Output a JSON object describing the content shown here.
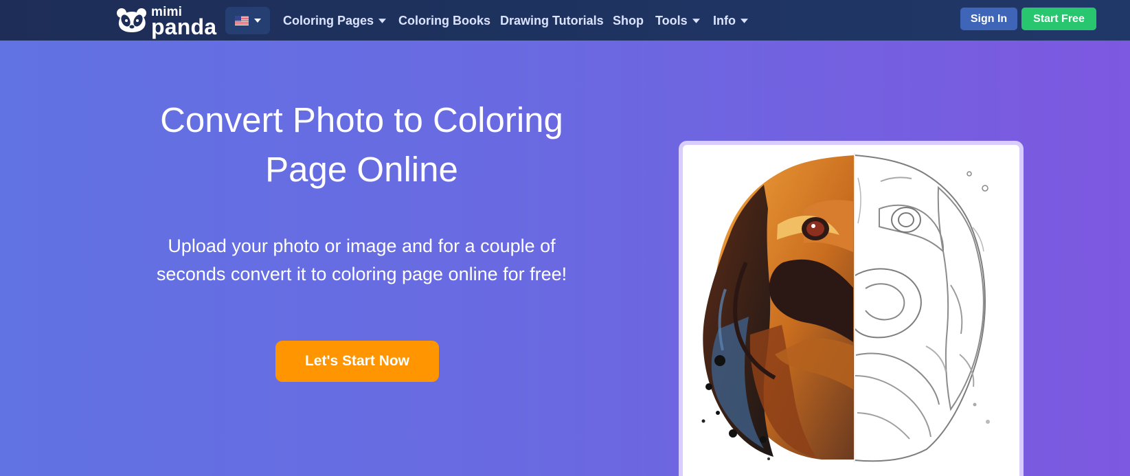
{
  "nav": {
    "logo": {
      "top_word": "mimi",
      "bottom_word": "panda",
      "icon": "panda-face-icon"
    },
    "language": {
      "flag": "us-flag-icon",
      "caret": "chevron-down-icon"
    },
    "items": [
      {
        "label": "Coloring Pages",
        "dropdown": true
      },
      {
        "label": "Coloring Books",
        "dropdown": false
      },
      {
        "label": "Drawing Tutorials",
        "dropdown": false
      },
      {
        "label": "Shop",
        "dropdown": false
      },
      {
        "label": "Tools",
        "dropdown": true
      },
      {
        "label": "Info",
        "dropdown": true
      }
    ],
    "signin_label": "Sign In",
    "start_free_label": "Start Free"
  },
  "hero": {
    "title": "Convert Photo to Coloring Page Online",
    "subtitle": "Upload your photo or image and for a couple of seconds convert it to coloring page online for free!",
    "cta_label": "Let's Start Now",
    "image": "half-colored-dog-illustration"
  },
  "colors": {
    "navbar": "#1d2d57",
    "hero_gradient_start": "#6172e2",
    "hero_gradient_end": "#7d58e0",
    "cta": "#ff9500",
    "sign_in": "#3e65b8",
    "start_free": "#28c76f",
    "image_frame": "#d9cdfd"
  }
}
